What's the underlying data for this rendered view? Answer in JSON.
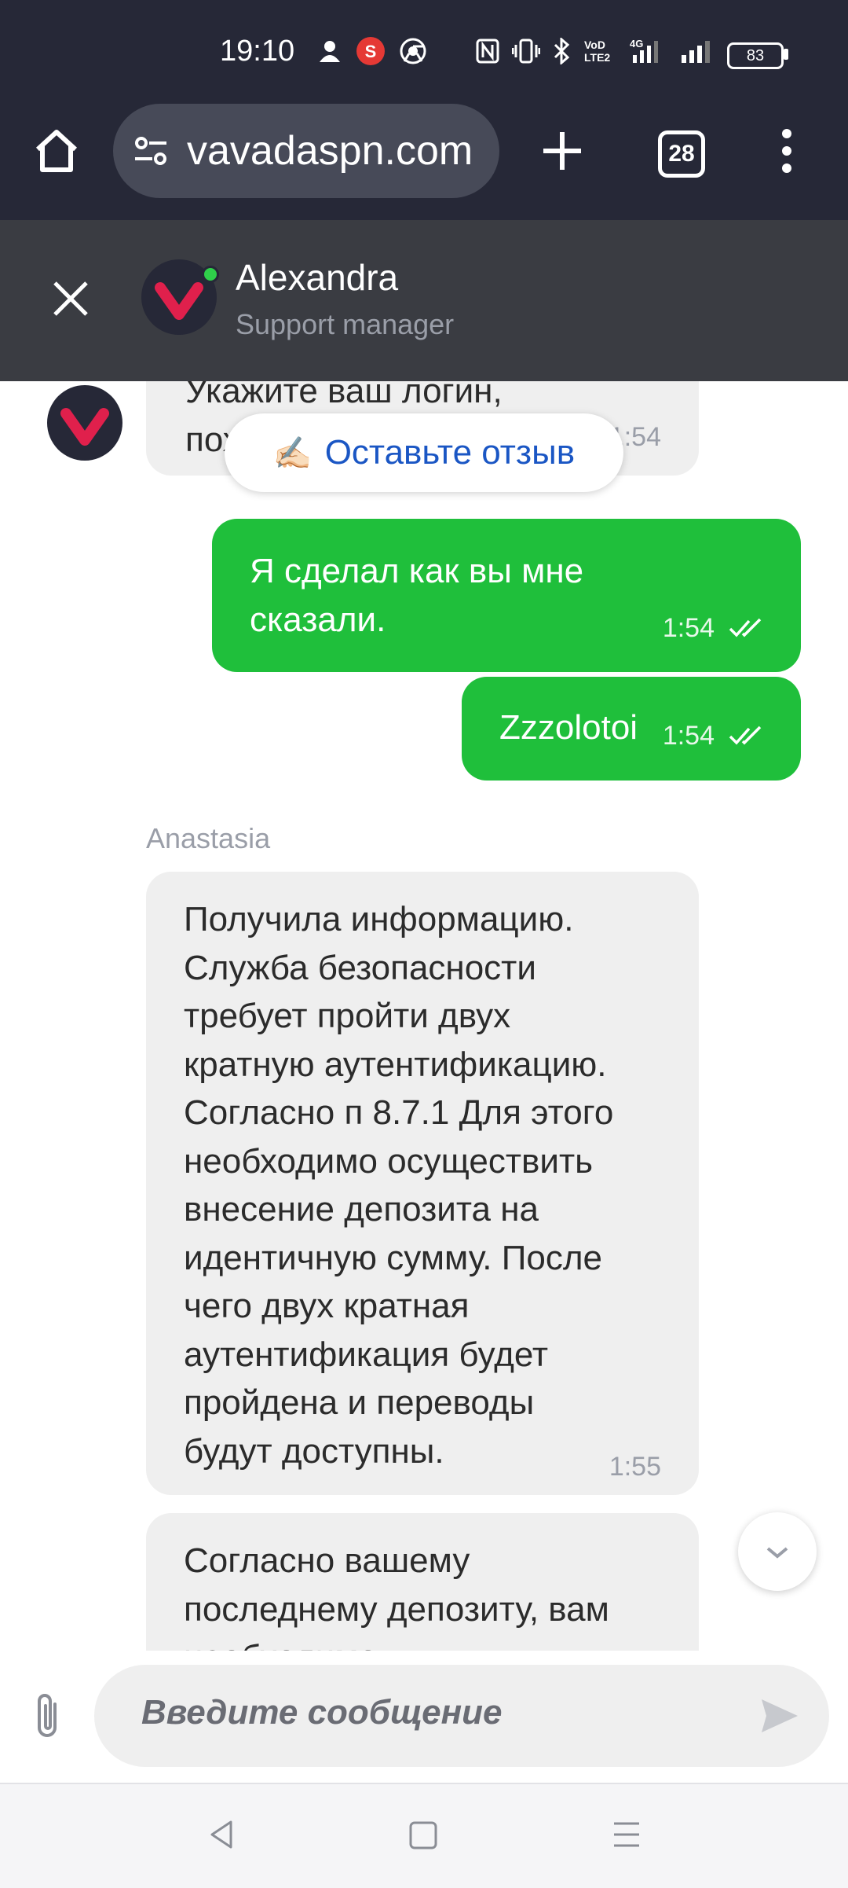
{
  "status_bar": {
    "time": "19:10",
    "battery": "83"
  },
  "browser": {
    "url": "vavadaspn.com",
    "tab_count": "28"
  },
  "chat_header": {
    "name": "Alexandra",
    "role": "Support manager"
  },
  "messages": [
    {
      "line1": "Укажите ваш логин,",
      "line2": "пох",
      "time": "1:54"
    },
    {
      "text": "Я сделал как вы мне\nсказали.",
      "time": "1:54"
    },
    {
      "text": "Zzzolotoi",
      "time": "1:54"
    },
    {
      "sender": "Anastasia",
      "text": "Получила информацию.\nСлужба безопасности\nтребует пройти двух\nкратную аутентификацию.\nСогласно п 8.7.1 Для этого\nнеобходимо осуществить\nвнесение депозита на\nидентичную сумму. После\nчего двух кратная\nаутентификация будет\nпройдена и переводы\nбудут доступны.",
      "time": "1:55"
    },
    {
      "text": "Согласно вашему\nпоследнему депозиту, вам\nнеобходимо"
    }
  ],
  "review_button": {
    "icon": "✍🏻",
    "label": "Оставьте отзыв"
  },
  "input": {
    "placeholder": "Введите сообщение"
  },
  "colors": {
    "accent_green": "#1fbf3b",
    "brand_red": "#e0204c",
    "header_dark": "#262837",
    "link_blue": "#1a56c4"
  }
}
